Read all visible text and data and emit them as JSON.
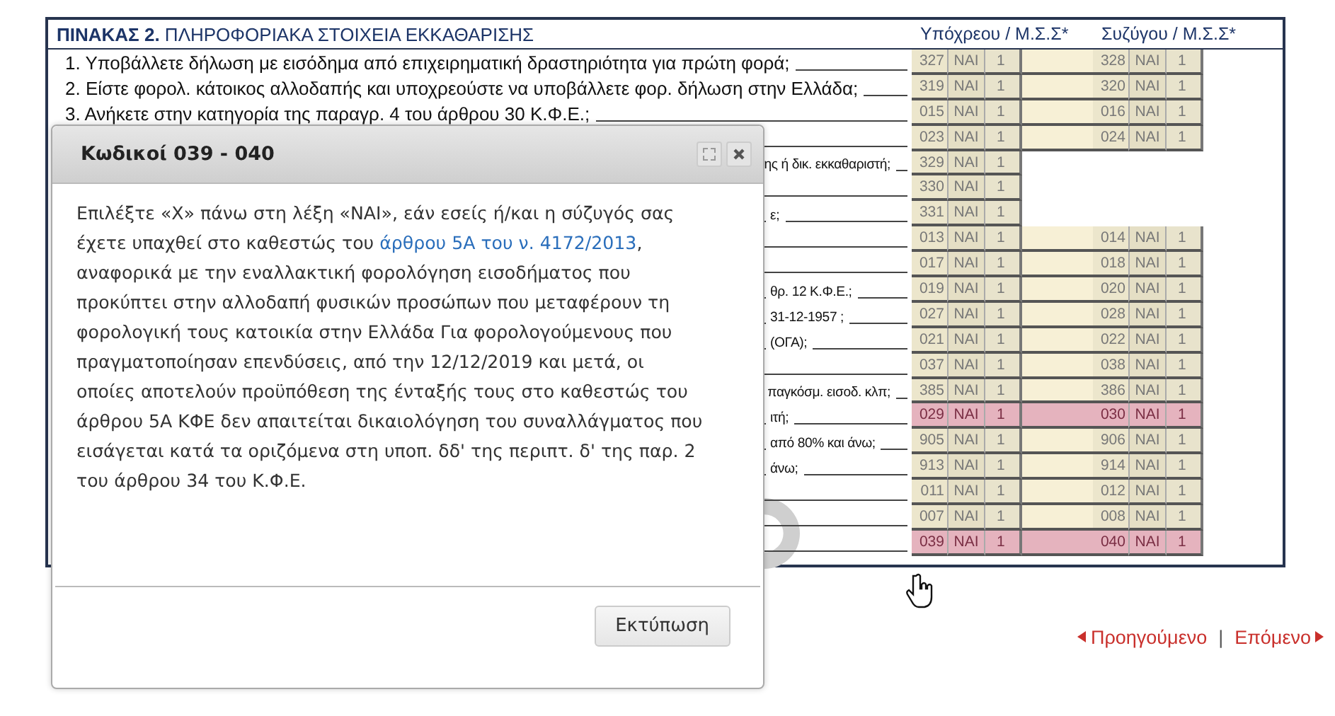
{
  "form": {
    "title": "**ΠΙΝΑΚΑΣ 2.** ΠΛΗΡΟΦΟΡΙΑΚΑ ΣΤΟΙΧΕΙΑ ΕΚΚΑΘΑΡΙΣΗΣ",
    "columns": [
      "Υπόχρεου / Μ.Σ.Σ*",
      "Συζύγου / Μ.Σ.Σ*"
    ],
    "rows": [
      {
        "kind": "question",
        "text": "1. Υποβάλλετε δήλωση με εισόδημα από επιχειρηματική δραστηριότητα για πρώτη φορά;",
        "highlighted": false,
        "fields": [
          {
            "code": "327",
            "answer": "ΝΑΙ",
            "value": "1"
          },
          {
            "code": "328",
            "answer": "ΝΑΙ",
            "value": "1"
          }
        ]
      },
      {
        "kind": "question",
        "text": "2. Είστε φορολ. κάτοικος αλλοδαπής και υποχρεούστε να υποβάλλετε φορ. δήλωση στην Ελλάδα;",
        "highlighted": false,
        "fields": [
          {
            "code": "319",
            "answer": "ΝΑΙ",
            "value": "1"
          },
          {
            "code": "320",
            "answer": "ΝΑΙ",
            "value": "1"
          }
        ]
      },
      {
        "kind": "question",
        "text": "3. Ανήκετε στην κατηγορία της παραγρ. 4 του άρθρου 30 Κ.Φ.Ε.;",
        "highlighted": false,
        "fields": [
          {
            "code": "015",
            "answer": "ΝΑΙ",
            "value": "1"
          },
          {
            "code": "016",
            "answer": "ΝΑΙ",
            "value": "1"
          }
        ]
      },
      {
        "kind": "blank",
        "highlighted": false,
        "fields": [
          {
            "code": "023",
            "answer": "ΝΑΙ",
            "value": "1"
          },
          {
            "code": "024",
            "answer": "ΝΑΙ",
            "value": "1"
          }
        ]
      },
      {
        "kind": "tail",
        "text": "ης ή δικ. εκκαθαριστή;",
        "highlighted": false,
        "fields": [
          {
            "code": "329",
            "answer": "ΝΑΙ",
            "value": "1"
          }
        ]
      },
      {
        "kind": "blank",
        "highlighted": false,
        "fields": [
          {
            "code": "330",
            "answer": "ΝΑΙ",
            "value": "1"
          }
        ]
      },
      {
        "kind": "tail",
        "text": "ε;",
        "highlighted": false,
        "fields": [
          {
            "code": "331",
            "answer": "ΝΑΙ",
            "value": "1"
          }
        ]
      },
      {
        "kind": "blank",
        "highlighted": false,
        "fields": [
          {
            "code": "013",
            "answer": "ΝΑΙ",
            "value": "1"
          },
          {
            "code": "014",
            "answer": "ΝΑΙ",
            "value": "1"
          }
        ]
      },
      {
        "kind": "blank",
        "highlighted": false,
        "fields": [
          {
            "code": "017",
            "answer": "ΝΑΙ",
            "value": "1"
          },
          {
            "code": "018",
            "answer": "ΝΑΙ",
            "value": "1"
          }
        ]
      },
      {
        "kind": "tail",
        "text": "θρ. 12 Κ.Φ.Ε.;",
        "highlighted": false,
        "fields": [
          {
            "code": "019",
            "answer": "ΝΑΙ",
            "value": "1"
          },
          {
            "code": "020",
            "answer": "ΝΑΙ",
            "value": "1"
          }
        ]
      },
      {
        "kind": "tail",
        "text": "31-12-1957 ;",
        "highlighted": false,
        "fields": [
          {
            "code": "027",
            "answer": "ΝΑΙ",
            "value": "1"
          },
          {
            "code": "028",
            "answer": "ΝΑΙ",
            "value": "1"
          }
        ]
      },
      {
        "kind": "tail",
        "text": "(ΟΓΑ);",
        "highlighted": false,
        "fields": [
          {
            "code": "021",
            "answer": "ΝΑΙ",
            "value": "1"
          },
          {
            "code": "022",
            "answer": "ΝΑΙ",
            "value": "1"
          }
        ]
      },
      {
        "kind": "blank",
        "highlighted": false,
        "fields": [
          {
            "code": "037",
            "answer": "ΝΑΙ",
            "value": "1"
          },
          {
            "code": "038",
            "answer": "ΝΑΙ",
            "value": "1"
          }
        ]
      },
      {
        "kind": "tail",
        "text": "παγκόσμ. εισοδ. κλπ;",
        "highlighted": false,
        "fields": [
          {
            "code": "385",
            "answer": "ΝΑΙ",
            "value": "1"
          },
          {
            "code": "386",
            "answer": "ΝΑΙ",
            "value": "1"
          }
        ]
      },
      {
        "kind": "tail",
        "text": "ιτή;",
        "highlighted": true,
        "fields": [
          {
            "code": "029",
            "answer": "ΝΑΙ",
            "value": "1"
          },
          {
            "code": "030",
            "answer": "ΝΑΙ",
            "value": "1"
          }
        ]
      },
      {
        "kind": "tail",
        "text": "από 80% και άνω;",
        "highlighted": false,
        "fields": [
          {
            "code": "905",
            "answer": "ΝΑΙ",
            "value": "1"
          },
          {
            "code": "906",
            "answer": "ΝΑΙ",
            "value": "1"
          }
        ]
      },
      {
        "kind": "tail",
        "text": "άνω;",
        "highlighted": false,
        "fields": [
          {
            "code": "913",
            "answer": "ΝΑΙ",
            "value": "1"
          },
          {
            "code": "914",
            "answer": "ΝΑΙ",
            "value": "1"
          }
        ]
      },
      {
        "kind": "blank",
        "highlighted": false,
        "fields": [
          {
            "code": "011",
            "answer": "ΝΑΙ",
            "value": "1"
          },
          {
            "code": "012",
            "answer": "ΝΑΙ",
            "value": "1"
          }
        ]
      },
      {
        "kind": "blank",
        "highlighted": false,
        "fields": [
          {
            "code": "007",
            "answer": "ΝΑΙ",
            "value": "1"
          },
          {
            "code": "008",
            "answer": "ΝΑΙ",
            "value": "1"
          }
        ]
      },
      {
        "kind": "blank",
        "highlighted": true,
        "fields": [
          {
            "code": "039",
            "answer": "ΝΑΙ",
            "value": "1"
          },
          {
            "code": "040",
            "answer": "ΝΑΙ",
            "value": "1"
          }
        ]
      }
    ]
  },
  "dialog": {
    "title": "Κωδικοί 039 - 040",
    "text_before": "Επιλέξτε «Χ» πάνω στη λέξη «ΝΑΙ», εάν εσείς ή/και η σύζυγός σας έχετε υπαχθεί στο καθεστώς του",
    "link": "άρθρου 5Α του ν. 4172/2013",
    "text_after": ", αναφορικά με την εναλλακτική φορολόγηση εισοδήματος που προκύπτει στην αλλοδαπή φυσικών προσώπων που μεταφέρουν τη φορολογική τους κατοικία στην Ελλάδα Για φορολογούμενους που πραγματοποίησαν επενδύσεις, από την 12/12/2019 και μετά, οι οποίες αποτελούν προϋπόθεση της ένταξής τους στο καθεστώς του άρθρου 5Α ΚΦΕ δεν απαιτείται δικαιολόγηση του συναλλάγματος που εισάγεται κατά τα οριζόμενα στη υποπ. δδ' της περιπτ. δ' της παρ. 2 του άρθρου 34 του Κ.Φ.Ε.",
    "button": "Εκτύπωση"
  },
  "pager": {
    "previous": "Προηγούμενο",
    "separator": "|",
    "next": "Επόμενο"
  }
}
